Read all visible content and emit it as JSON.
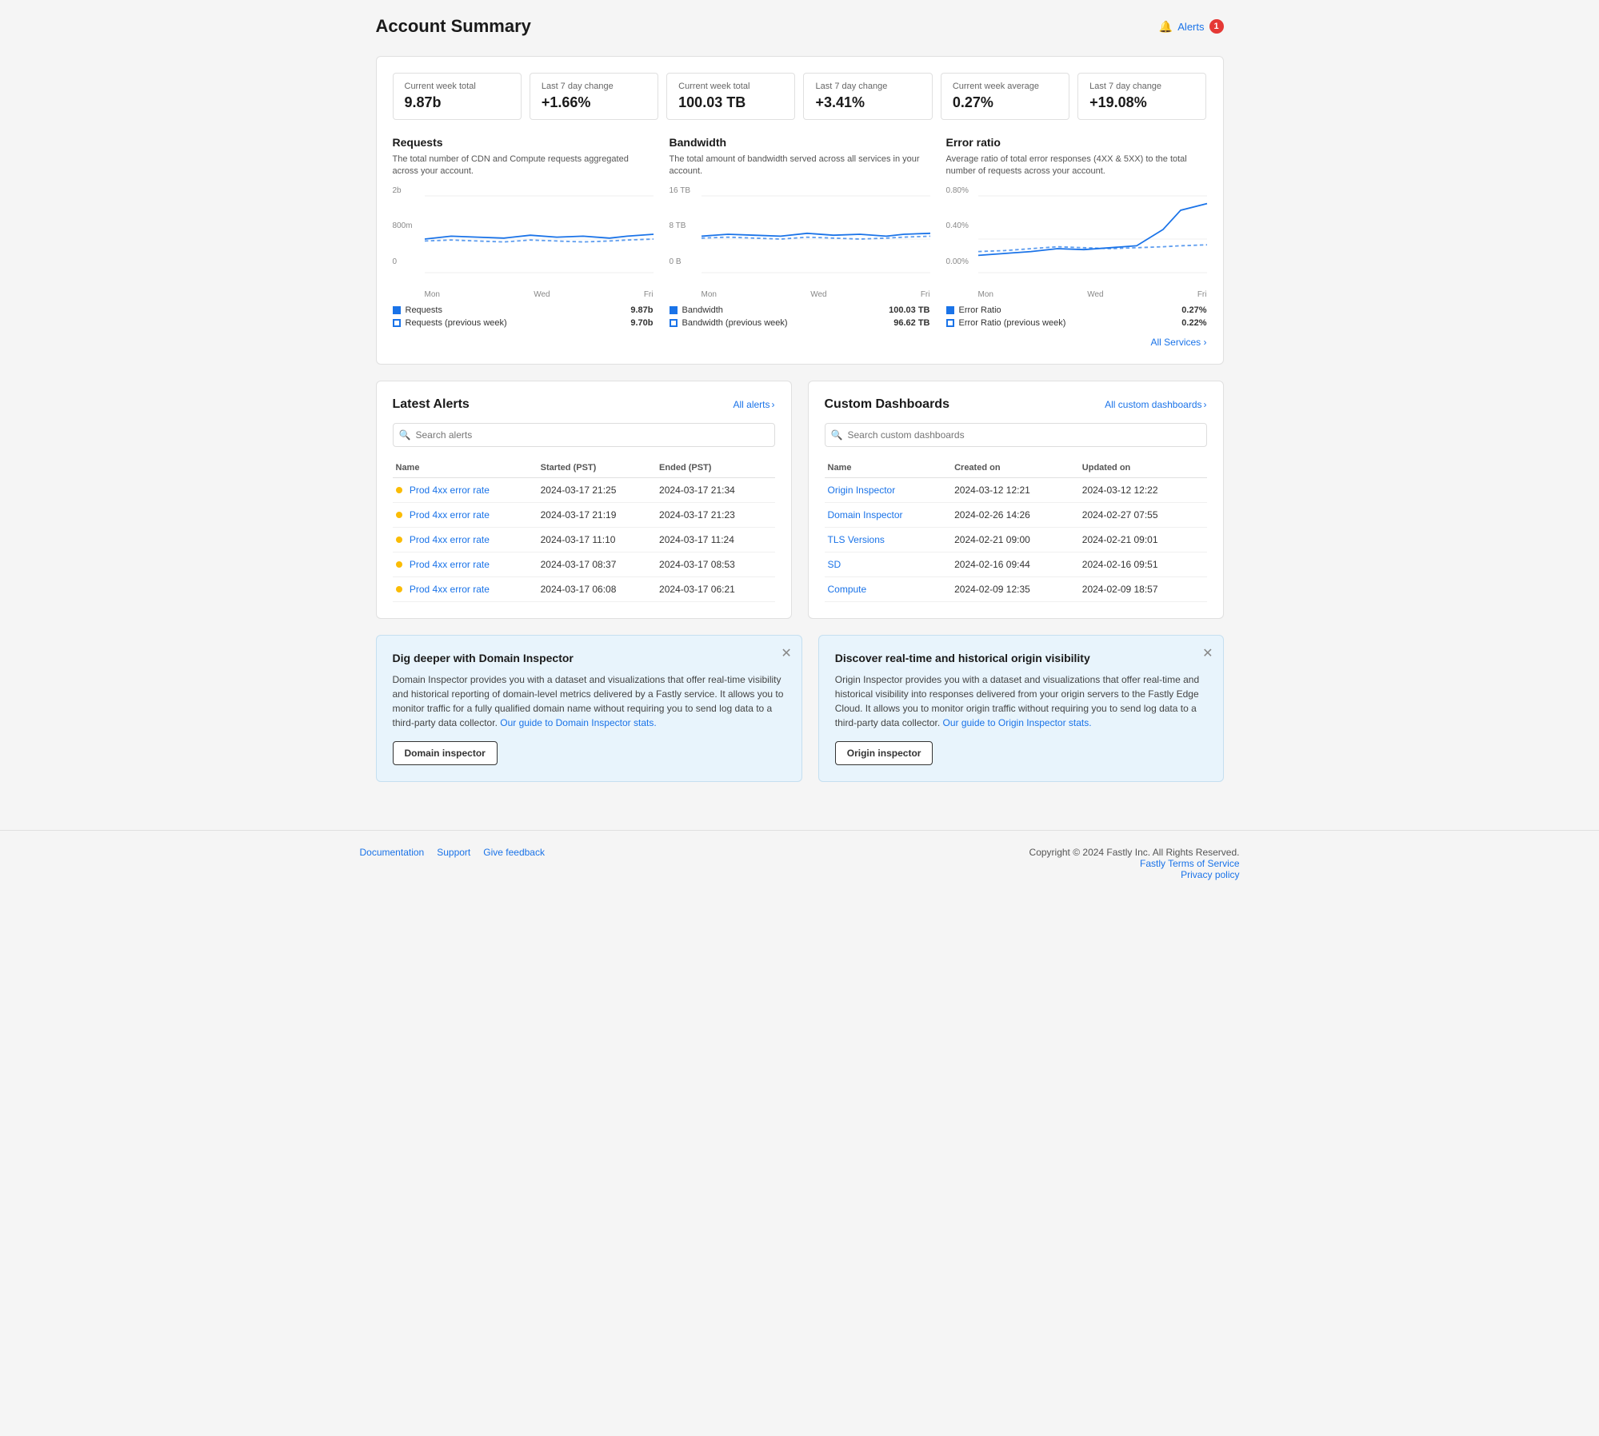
{
  "header": {
    "title": "Account Summary",
    "alerts_label": "Alerts",
    "alerts_count": "1"
  },
  "stats": [
    {
      "label": "Current week total",
      "value": "9.87b",
      "group": "requests"
    },
    {
      "label": "Last 7 day change",
      "value": "+1.66%",
      "group": "requests"
    },
    {
      "label": "Current week total",
      "value": "100.03 TB",
      "group": "bandwidth"
    },
    {
      "label": "Last 7 day change",
      "value": "+3.41%",
      "group": "bandwidth"
    },
    {
      "label": "Current week average",
      "value": "0.27%",
      "group": "error"
    },
    {
      "label": "Last 7 day change",
      "value": "+19.08%",
      "group": "error"
    }
  ],
  "charts": {
    "requests": {
      "title": "Requests",
      "description": "The total number of CDN and Compute requests aggregated across your account.",
      "y_max": "2b",
      "y_mid": "800m",
      "y_min": "0",
      "x_labels": [
        "Mon",
        "Wed",
        "Fri"
      ],
      "legend": [
        {
          "label": "Requests",
          "value": "9.87b",
          "type": "solid"
        },
        {
          "label": "Requests (previous week)",
          "value": "9.70b",
          "type": "dashed"
        }
      ]
    },
    "bandwidth": {
      "title": "Bandwidth",
      "description": "The total amount of bandwidth served across all services in your account.",
      "y_max": "16 TB",
      "y_mid": "8 TB",
      "y_min": "0 B",
      "x_labels": [
        "Mon",
        "Wed",
        "Fri"
      ],
      "legend": [
        {
          "label": "Bandwidth",
          "value": "100.03 TB",
          "type": "solid"
        },
        {
          "label": "Bandwidth (previous week)",
          "value": "96.62 TB",
          "type": "dashed"
        }
      ]
    },
    "error": {
      "title": "Error ratio",
      "description": "Average ratio of total error responses (4XX & 5XX) to the total number of requests across your account.",
      "y_max": "0.80%",
      "y_mid": "0.40%",
      "y_min": "0.00%",
      "x_labels": [
        "Mon",
        "Wed",
        "Fri"
      ],
      "legend": [
        {
          "label": "Error Ratio",
          "value": "0.27%",
          "type": "solid"
        },
        {
          "label": "Error Ratio (previous week)",
          "value": "0.22%",
          "type": "dashed"
        }
      ]
    }
  },
  "all_services_label": "All Services",
  "latest_alerts": {
    "title": "Latest Alerts",
    "all_label": "All alerts",
    "search_placeholder": "Search alerts",
    "columns": [
      "Name",
      "Started (PST)",
      "Ended (PST)"
    ],
    "rows": [
      {
        "name": "Prod 4xx error rate",
        "started": "2024-03-17 21:25",
        "ended": "2024-03-17 21:34"
      },
      {
        "name": "Prod 4xx error rate",
        "started": "2024-03-17 21:19",
        "ended": "2024-03-17 21:23"
      },
      {
        "name": "Prod 4xx error rate",
        "started": "2024-03-17 11:10",
        "ended": "2024-03-17 11:24"
      },
      {
        "name": "Prod 4xx error rate",
        "started": "2024-03-17 08:37",
        "ended": "2024-03-17 08:53"
      },
      {
        "name": "Prod 4xx error rate",
        "started": "2024-03-17 06:08",
        "ended": "2024-03-17 06:21"
      }
    ]
  },
  "custom_dashboards": {
    "title": "Custom Dashboards",
    "all_label": "All custom dashboards",
    "search_placeholder": "Search custom dashboards",
    "columns": [
      "Name",
      "Created on",
      "Updated on"
    ],
    "rows": [
      {
        "name": "Origin Inspector",
        "created": "2024-03-12 12:21",
        "updated": "2024-03-12 12:22"
      },
      {
        "name": "Domain Inspector",
        "created": "2024-02-26 14:26",
        "updated": "2024-02-27 07:55"
      },
      {
        "name": "TLS Versions",
        "created": "2024-02-21 09:00",
        "updated": "2024-02-21 09:01"
      },
      {
        "name": "SD",
        "created": "2024-02-16 09:44",
        "updated": "2024-02-16 09:51"
      },
      {
        "name": "Compute",
        "created": "2024-02-09 12:35",
        "updated": "2024-02-09 18:57"
      }
    ]
  },
  "domain_promo": {
    "title": "Dig deeper with Domain Inspector",
    "text": "Domain Inspector provides you with a dataset and visualizations that offer real-time visibility and historical reporting of domain-level metrics delivered by a Fastly service. It allows you to monitor traffic for a fully qualified domain name without requiring you to send log data to a third-party data collector.",
    "link_text": "Our guide to Domain Inspector stats.",
    "button_label": "Domain inspector"
  },
  "origin_promo": {
    "title": "Discover real-time and historical origin visibility",
    "text": "Origin Inspector provides you with a dataset and visualizations that offer real-time and historical visibility into responses delivered from your origin servers to the Fastly Edge Cloud. It allows you to monitor origin traffic without requiring you to send log data to a third-party data collector.",
    "link_text": "Our guide to Origin Inspector stats.",
    "button_label": "Origin inspector"
  },
  "footer": {
    "links": [
      "Documentation",
      "Support",
      "Give feedback"
    ],
    "copyright": "Copyright © 2024 Fastly Inc. All Rights Reserved.",
    "terms_label": "Fastly Terms of Service",
    "privacy_label": "Privacy policy"
  }
}
